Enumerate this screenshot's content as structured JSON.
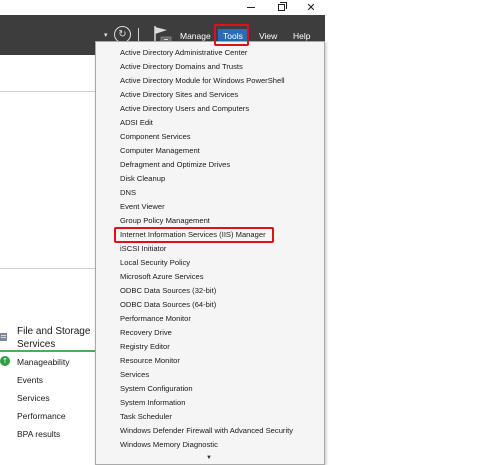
{
  "window": {
    "minimize_icon": "minimize-icon",
    "maximize_icon": "restore-icon",
    "close_glyph": "✕"
  },
  "header": {
    "dropdown_glyph": "▾",
    "refresh_glyph": "↻",
    "menu": {
      "manage": "Manage",
      "tools": "Tools",
      "view": "View",
      "help": "Help"
    },
    "colors": {
      "background": "#3d3d3d",
      "tools_active": "#2b6cb4",
      "highlight_outline": "#e0101a"
    }
  },
  "tools_menu": {
    "items": [
      "Active Directory Administrative Center",
      "Active Directory Domains and Trusts",
      "Active Directory Module for Windows PowerShell",
      "Active Directory Sites and Services",
      "Active Directory Users and Computers",
      "ADSI Edit",
      "Component Services",
      "Computer Management",
      "Defragment and Optimize Drives",
      "Disk Cleanup",
      "DNS",
      "Event Viewer",
      "Group Policy Management",
      "Internet Information Services (IIS) Manager",
      "iSCSI Initiator",
      "Local Security Policy",
      "Microsoft Azure Services",
      "ODBC Data Sources (32-bit)",
      "ODBC Data Sources (64-bit)",
      "Performance Monitor",
      "Recovery Drive",
      "Registry Editor",
      "Resource Monitor",
      "Services",
      "System Configuration",
      "System Information",
      "Task Scheduler",
      "Windows Defender Firewall with Advanced Security",
      "Windows Memory Diagnostic"
    ],
    "highlighted": "Internet Information Services (IIS) Manager",
    "scroll_glyph": "▼"
  },
  "role_tile": {
    "title_line1": "File and Storage",
    "title_line2": "Services",
    "status_glyph": "↑",
    "rows": [
      "Manageability",
      "Events",
      "Services",
      "Performance",
      "BPA results"
    ],
    "accent_color": "#4caf50"
  }
}
